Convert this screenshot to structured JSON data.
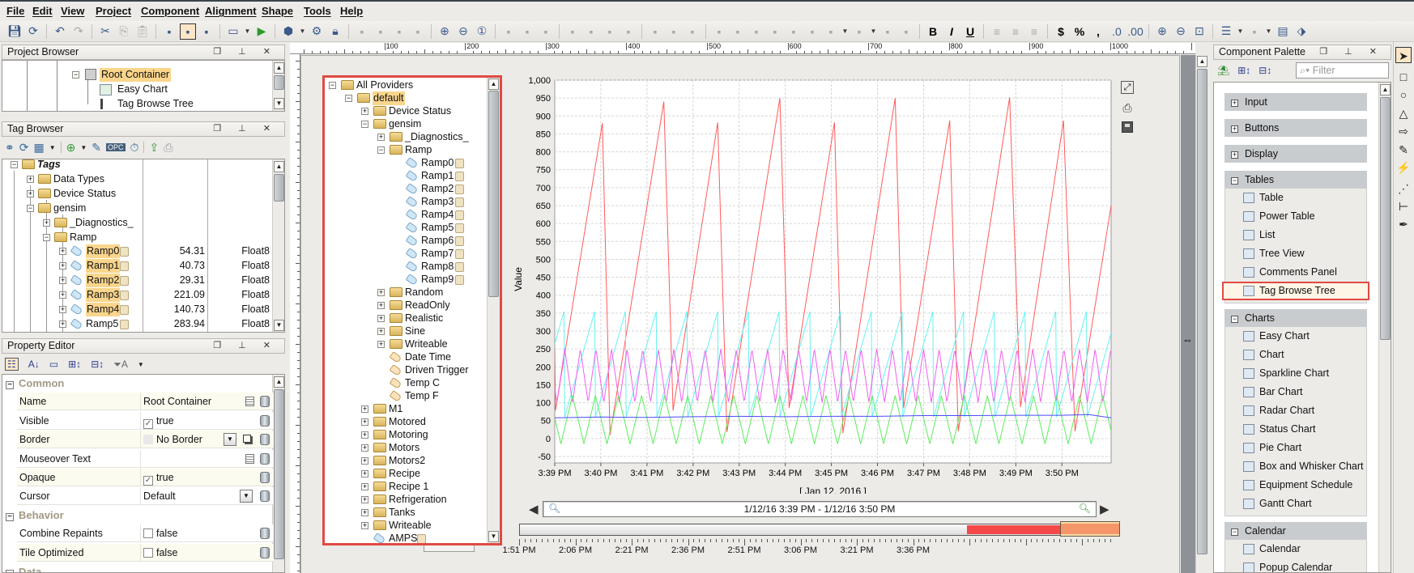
{
  "menu": [
    "File",
    "Edit",
    "View",
    "Project",
    "Component",
    "Alignment",
    "Shape",
    "Tools",
    "Help"
  ],
  "toolbar_icons": [
    "save-icon",
    "update-project-icon",
    "|",
    "undo-icon",
    "redo-icon",
    "|",
    "cut-icon",
    "copy-icon",
    "paste-icon",
    "|",
    "comm-off-icon",
    "comm-read-only-icon",
    "comm-read-write-icon",
    "|",
    "new-window-icon",
    "dropdown",
    "launch-preview-icon",
    "|",
    "publish-icon",
    "dropdown",
    "settings-gears-icon",
    "lock-icon",
    "|",
    "group-icon",
    "ungroup-icon",
    "union-icon",
    "difference-icon",
    "|",
    "zoom-in-icon",
    "zoom-out-icon",
    "zoom-actual-icon",
    "|",
    "move-to-back-icon",
    "move-to-front-icon",
    "move-up-icon",
    "|",
    "rotate-icon",
    "rotate-back-icon",
    "flip-horizontal-icon",
    "flip-vertical-icon",
    "|",
    "shape-union-icon",
    "shape-intersect-icon",
    "shape-exclude-icon",
    "|",
    "align-left-icon",
    "align-right-icon",
    "align-top-icon",
    "align-bottom-icon",
    "align-center-vertical-icon",
    "align-center-horizontal-icon",
    "distribute-horizontal-icon",
    "dropdown",
    "distribute-vertical-icon",
    "dropdown",
    "same-width-icon",
    "same-height-icon",
    "|",
    "bold-icon",
    "italic-icon",
    "underline-icon",
    "|",
    "text-align-left-icon",
    "text-align-center-icon",
    "text-align-right-icon",
    "|",
    "currency-icon",
    "percent-icon",
    "comma-icon",
    "decimal-increase-icon",
    "decimal-decrease-icon",
    "|",
    "zoom-in-icon",
    "zoom-out-icon",
    "zoom-fit-icon",
    "|",
    "bookmark-icon",
    "dropdown",
    "tag-disabled-icon",
    "dropdown",
    "opc-icon",
    "tag-icon"
  ],
  "project_browser": {
    "title": "Project Browser",
    "items": [
      {
        "label": "Root Container",
        "selected": true
      },
      {
        "label": "Easy Chart"
      },
      {
        "label": "Tag Browse Tree"
      }
    ]
  },
  "tag_browser": {
    "title": "Tag Browser",
    "rows": [
      {
        "label": "Tags",
        "level": 0,
        "exp": "-",
        "icon": "tag-folder",
        "bold": true
      },
      {
        "label": "Data Types",
        "level": 1,
        "exp": "+",
        "icon": "folder"
      },
      {
        "label": "Device Status",
        "level": 1,
        "exp": "+",
        "icon": "folder"
      },
      {
        "label": "gensim",
        "level": 1,
        "exp": "-",
        "icon": "folder"
      },
      {
        "label": "_Diagnostics_",
        "level": 2,
        "exp": "+",
        "icon": "folder"
      },
      {
        "label": "Ramp",
        "level": 2,
        "exp": "-",
        "icon": "folder"
      },
      {
        "label": "Ramp0",
        "level": 3,
        "exp": "+",
        "icon": "tag",
        "doc": true,
        "hl": true,
        "value": "54.31",
        "type": "Float8"
      },
      {
        "label": "Ramp1",
        "level": 3,
        "exp": "+",
        "icon": "tag",
        "doc": true,
        "hl": true,
        "value": "40.73",
        "type": "Float8"
      },
      {
        "label": "Ramp2",
        "level": 3,
        "exp": "+",
        "icon": "tag",
        "doc": true,
        "hl": true,
        "value": "29.31",
        "type": "Float8"
      },
      {
        "label": "Ramp3",
        "level": 3,
        "exp": "+",
        "icon": "tag",
        "doc": true,
        "hl": true,
        "value": "221.09",
        "type": "Float8"
      },
      {
        "label": "Ramp4",
        "level": 3,
        "exp": "+",
        "icon": "tag",
        "doc": true,
        "hl": true,
        "value": "140.73",
        "type": "Float8"
      },
      {
        "label": "Ramp5",
        "level": 3,
        "exp": "+",
        "icon": "tag",
        "doc": true,
        "value": "283.94",
        "type": "Float8"
      }
    ]
  },
  "property_editor": {
    "title": "Property Editor",
    "rows": [
      {
        "group": "Common"
      },
      {
        "label": "Name",
        "value": "Root Container",
        "editor": true
      },
      {
        "label": "Visible",
        "value": "true",
        "check": true
      },
      {
        "label": "Border",
        "value": "No Border",
        "swatch": true,
        "dropdown": true,
        "popup": true
      },
      {
        "label": "Mouseover Text",
        "value": "",
        "editor": true
      },
      {
        "label": "Opaque",
        "value": "true",
        "check": true
      },
      {
        "label": "Cursor",
        "value": "Default",
        "dropdown": true
      },
      {
        "group": "Behavior"
      },
      {
        "label": "Combine Repaints",
        "value": "false",
        "check": false
      },
      {
        "label": "Tile Optimized",
        "value": "false",
        "check": false
      },
      {
        "group": "Data"
      }
    ]
  },
  "ruler": {
    "labels": [
      "100",
      "200",
      "300",
      "400",
      "500",
      "600",
      "700",
      "800",
      "900",
      "1000"
    ]
  },
  "tag_browse_tree": {
    "rows": [
      {
        "label": "All Providers",
        "level": 0,
        "exp": "-",
        "icon": "folder"
      },
      {
        "label": "default",
        "level": 1,
        "exp": "-",
        "icon": "folder",
        "hl": true
      },
      {
        "label": "Device Status",
        "level": 2,
        "exp": "+",
        "icon": "folder"
      },
      {
        "label": "gensim",
        "level": 2,
        "exp": "-",
        "icon": "folder"
      },
      {
        "label": "_Diagnostics_",
        "level": 3,
        "exp": "+",
        "icon": "folder"
      },
      {
        "label": "Ramp",
        "level": 3,
        "exp": "-",
        "icon": "folder"
      },
      {
        "label": "Ramp0",
        "level": 4,
        "icon": "tag",
        "doc": true
      },
      {
        "label": "Ramp1",
        "level": 4,
        "icon": "tag",
        "doc": true
      },
      {
        "label": "Ramp2",
        "level": 4,
        "icon": "tag",
        "doc": true
      },
      {
        "label": "Ramp3",
        "level": 4,
        "icon": "tag",
        "doc": true
      },
      {
        "label": "Ramp4",
        "level": 4,
        "icon": "tag",
        "doc": true
      },
      {
        "label": "Ramp5",
        "level": 4,
        "icon": "tag",
        "doc": true
      },
      {
        "label": "Ramp6",
        "level": 4,
        "icon": "tag",
        "doc": true
      },
      {
        "label": "Ramp7",
        "level": 4,
        "icon": "tag",
        "doc": true
      },
      {
        "label": "Ramp8",
        "level": 4,
        "icon": "tag",
        "doc": true
      },
      {
        "label": "Ramp9",
        "level": 4,
        "icon": "tag",
        "doc": true
      },
      {
        "label": "Random",
        "level": 3,
        "exp": "+",
        "icon": "folder"
      },
      {
        "label": "ReadOnly",
        "level": 3,
        "exp": "+",
        "icon": "folder"
      },
      {
        "label": "Realistic",
        "level": 3,
        "exp": "+",
        "icon": "folder"
      },
      {
        "label": "Sine",
        "level": 3,
        "exp": "+",
        "icon": "folder"
      },
      {
        "label": "Writeable",
        "level": 3,
        "exp": "+",
        "icon": "folder"
      },
      {
        "label": "Date Time",
        "level": 3,
        "icon": "tag-orange"
      },
      {
        "label": "Driven Trigger",
        "level": 3,
        "icon": "tag-orange"
      },
      {
        "label": "Temp C",
        "level": 3,
        "icon": "tag-orange"
      },
      {
        "label": "Temp F",
        "level": 3,
        "icon": "tag-orange"
      },
      {
        "label": "M1",
        "level": 2,
        "exp": "+",
        "icon": "folder"
      },
      {
        "label": "Motored",
        "level": 2,
        "exp": "+",
        "icon": "folder"
      },
      {
        "label": "Motoring",
        "level": 2,
        "exp": "+",
        "icon": "folder"
      },
      {
        "label": "Motors",
        "level": 2,
        "exp": "+",
        "icon": "folder"
      },
      {
        "label": "Motors2",
        "level": 2,
        "exp": "+",
        "icon": "folder"
      },
      {
        "label": "Recipe",
        "level": 2,
        "exp": "+",
        "icon": "folder"
      },
      {
        "label": "Recipe 1",
        "level": 2,
        "exp": "+",
        "icon": "folder"
      },
      {
        "label": "Refrigeration",
        "level": 2,
        "exp": "+",
        "icon": "folder"
      },
      {
        "label": "Tanks",
        "level": 2,
        "exp": "+",
        "icon": "folder"
      },
      {
        "label": "Writeable",
        "level": 2,
        "exp": "+",
        "icon": "folder"
      },
      {
        "label": "AMPS",
        "level": 2,
        "icon": "tag",
        "doc": true
      }
    ]
  },
  "chart_data": {
    "type": "line",
    "ylabel": "Value",
    "xlabel": "[ Jan 12, 2016 ]",
    "x_range": [
      "15:39:00",
      "15:51:04"
    ],
    "ylim": [
      -68,
      1000
    ],
    "grid": true,
    "x_tick_labels": [
      "3:39 PM",
      "3:40 PM",
      "3:41 PM",
      "3:42 PM",
      "3:43 PM",
      "3:44 PM",
      "3:45 PM",
      "3:46 PM",
      "3:47 PM",
      "3:48 PM",
      "3:49 PM",
      "3:50 PM"
    ],
    "y_tick_labels": [
      "-50",
      "0",
      "50",
      "100",
      "150",
      "200",
      "250",
      "300",
      "350",
      "400",
      "450",
      "500",
      "550",
      "600",
      "650",
      "700",
      "750",
      "800",
      "850",
      "900",
      "950",
      "1,000"
    ],
    "series": [
      {
        "color": "#ff5a5a",
        "points": [
          [
            "15:39:00",
            250
          ],
          [
            "15:39:01",
            78
          ],
          [
            "15:40:02",
            880
          ],
          [
            "15:40:12",
            10
          ],
          [
            "15:41:22",
            940
          ],
          [
            "15:41:34",
            78
          ],
          [
            "15:42:32",
            882
          ],
          [
            "15:42:44",
            18
          ],
          [
            "15:43:53",
            950
          ],
          [
            "15:44:05",
            85
          ],
          [
            "15:45:04",
            882
          ],
          [
            "15:45:15",
            15
          ],
          [
            "15:46:23",
            950
          ],
          [
            "15:46:34",
            85
          ],
          [
            "15:47:34",
            887
          ],
          [
            "15:47:45",
            20
          ],
          [
            "15:48:52",
            952
          ],
          [
            "15:49:06",
            88
          ],
          [
            "15:50:02",
            887
          ],
          [
            "15:50:17",
            20
          ],
          [
            "15:51:04",
            650
          ]
        ]
      },
      {
        "color": "#66f2f2",
        "waveform": "sawtooth",
        "min": 60,
        "max": 362,
        "period_s": 40,
        "first_peak": "15:39:13"
      },
      {
        "color": "#f060f0",
        "waveform": "triangle",
        "min": 100,
        "max": 250,
        "period_s": 20.3,
        "first_peak": "15:39:13"
      },
      {
        "color": "#5ced5c",
        "waveform": "triangle",
        "min": -15,
        "max": 120,
        "period_s": 30,
        "first_peak": "15:39:23"
      },
      {
        "color": "#4a4aff",
        "points": [
          [
            "15:39:00",
            58
          ],
          [
            "15:40:00",
            60
          ],
          [
            "15:41:00",
            59
          ],
          [
            "15:42:00",
            61
          ],
          [
            "15:43:00",
            62
          ],
          [
            "15:44:00",
            61
          ],
          [
            "15:45:00",
            62
          ],
          [
            "15:46:00",
            62
          ],
          [
            "15:47:00",
            64
          ],
          [
            "15:48:00",
            64
          ],
          [
            "15:49:00",
            65
          ],
          [
            "15:50:00",
            65
          ],
          [
            "15:50:35",
            67
          ],
          [
            "15:51:04",
            58
          ]
        ]
      }
    ]
  },
  "range_bar": {
    "text": "1/12/16 3:39 PM - 1/12/16 3:50 PM",
    "overview_labels": [
      "1:51 PM",
      "2:06 PM",
      "2:21 PM",
      "2:36 PM",
      "2:51 PM",
      "3:06 PM",
      "3:21 PM",
      "3:36 PM"
    ]
  },
  "palette": {
    "title": "Component Palette",
    "filter_placeholder": "Filter",
    "groups": [
      {
        "label": "Input",
        "expanded": false,
        "items": []
      },
      {
        "label": "Buttons",
        "expanded": false,
        "items": []
      },
      {
        "label": "Display",
        "expanded": false,
        "items": []
      },
      {
        "label": "Tables",
        "expanded": true,
        "items": [
          "Table",
          "Power Table",
          "List",
          "Tree View",
          "Comments Panel",
          "Tag Browse Tree"
        ]
      },
      {
        "label": "Charts",
        "expanded": true,
        "items": [
          "Easy Chart",
          "Chart",
          "Sparkline Chart",
          "Bar Chart",
          "Radar Chart",
          "Status Chart",
          "Pie Chart",
          "Box and Whisker Chart",
          "Equipment Schedule",
          "Gantt Chart"
        ]
      },
      {
        "label": "Calendar",
        "expanded": true,
        "items": [
          "Calendar",
          "Popup Calendar"
        ]
      }
    ],
    "selected_item": "Tag Browse Tree"
  },
  "tools": [
    "pointer-tool-icon",
    "rectangle-tool-icon",
    "ellipse-tool-icon",
    "polygon-tool-icon",
    "arrow-tool-icon",
    "pencil-tool-icon",
    "line-tool-icon",
    "path-tool-icon",
    "pipe-tool-icon",
    "eyedropper-tool-icon"
  ],
  "colors": {
    "selection_outline": "#e14a44",
    "highlight": "#fad58c"
  }
}
